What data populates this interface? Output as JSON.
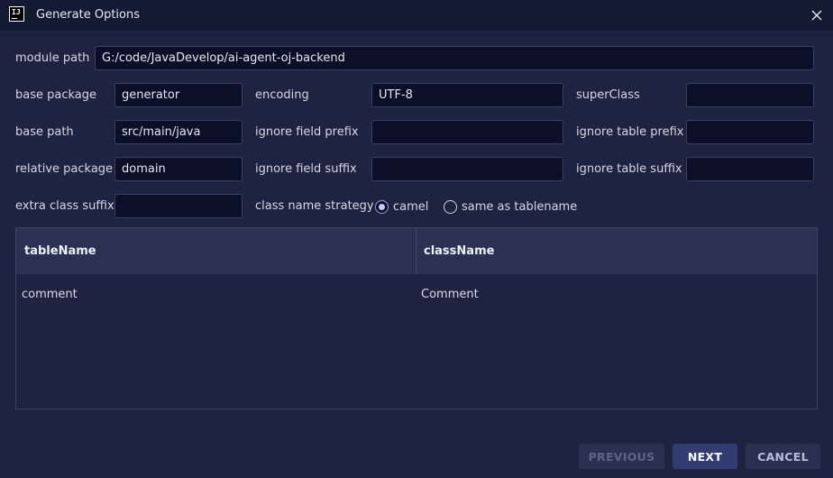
{
  "window": {
    "title": "Generate Options",
    "app_icon_text": "IJ"
  },
  "form": {
    "module_path": {
      "label": "module path",
      "value": "G:/code/JavaDevelop/ai-agent-oj-backend"
    },
    "base_package": {
      "label": "base package",
      "value": "generator"
    },
    "encoding": {
      "label": "encoding",
      "value": "UTF-8"
    },
    "super_class": {
      "label": "superClass",
      "value": ""
    },
    "base_path": {
      "label": "base path",
      "value": "src/main/java"
    },
    "ignore_field_prefix": {
      "label": "ignore field prefix",
      "value": ""
    },
    "ignore_table_prefix": {
      "label": "ignore table prefix",
      "value": ""
    },
    "relative_package": {
      "label": "relative package",
      "value": "domain"
    },
    "ignore_field_suffix": {
      "label": "ignore field suffix",
      "value": ""
    },
    "ignore_table_suffix": {
      "label": "ignore table suffix",
      "value": ""
    },
    "extra_class_suffix": {
      "label": "extra class suffix",
      "value": ""
    },
    "class_name_strategy": {
      "label": "class name strategy",
      "options": [
        "camel",
        "same as tablename"
      ],
      "selected": "camel"
    }
  },
  "table": {
    "headers": [
      "tableName",
      "className"
    ],
    "rows": [
      [
        "comment",
        "Comment"
      ]
    ]
  },
  "buttons": {
    "previous": "PREVIOUS",
    "next": "NEXT",
    "cancel": "CANCEL"
  }
}
